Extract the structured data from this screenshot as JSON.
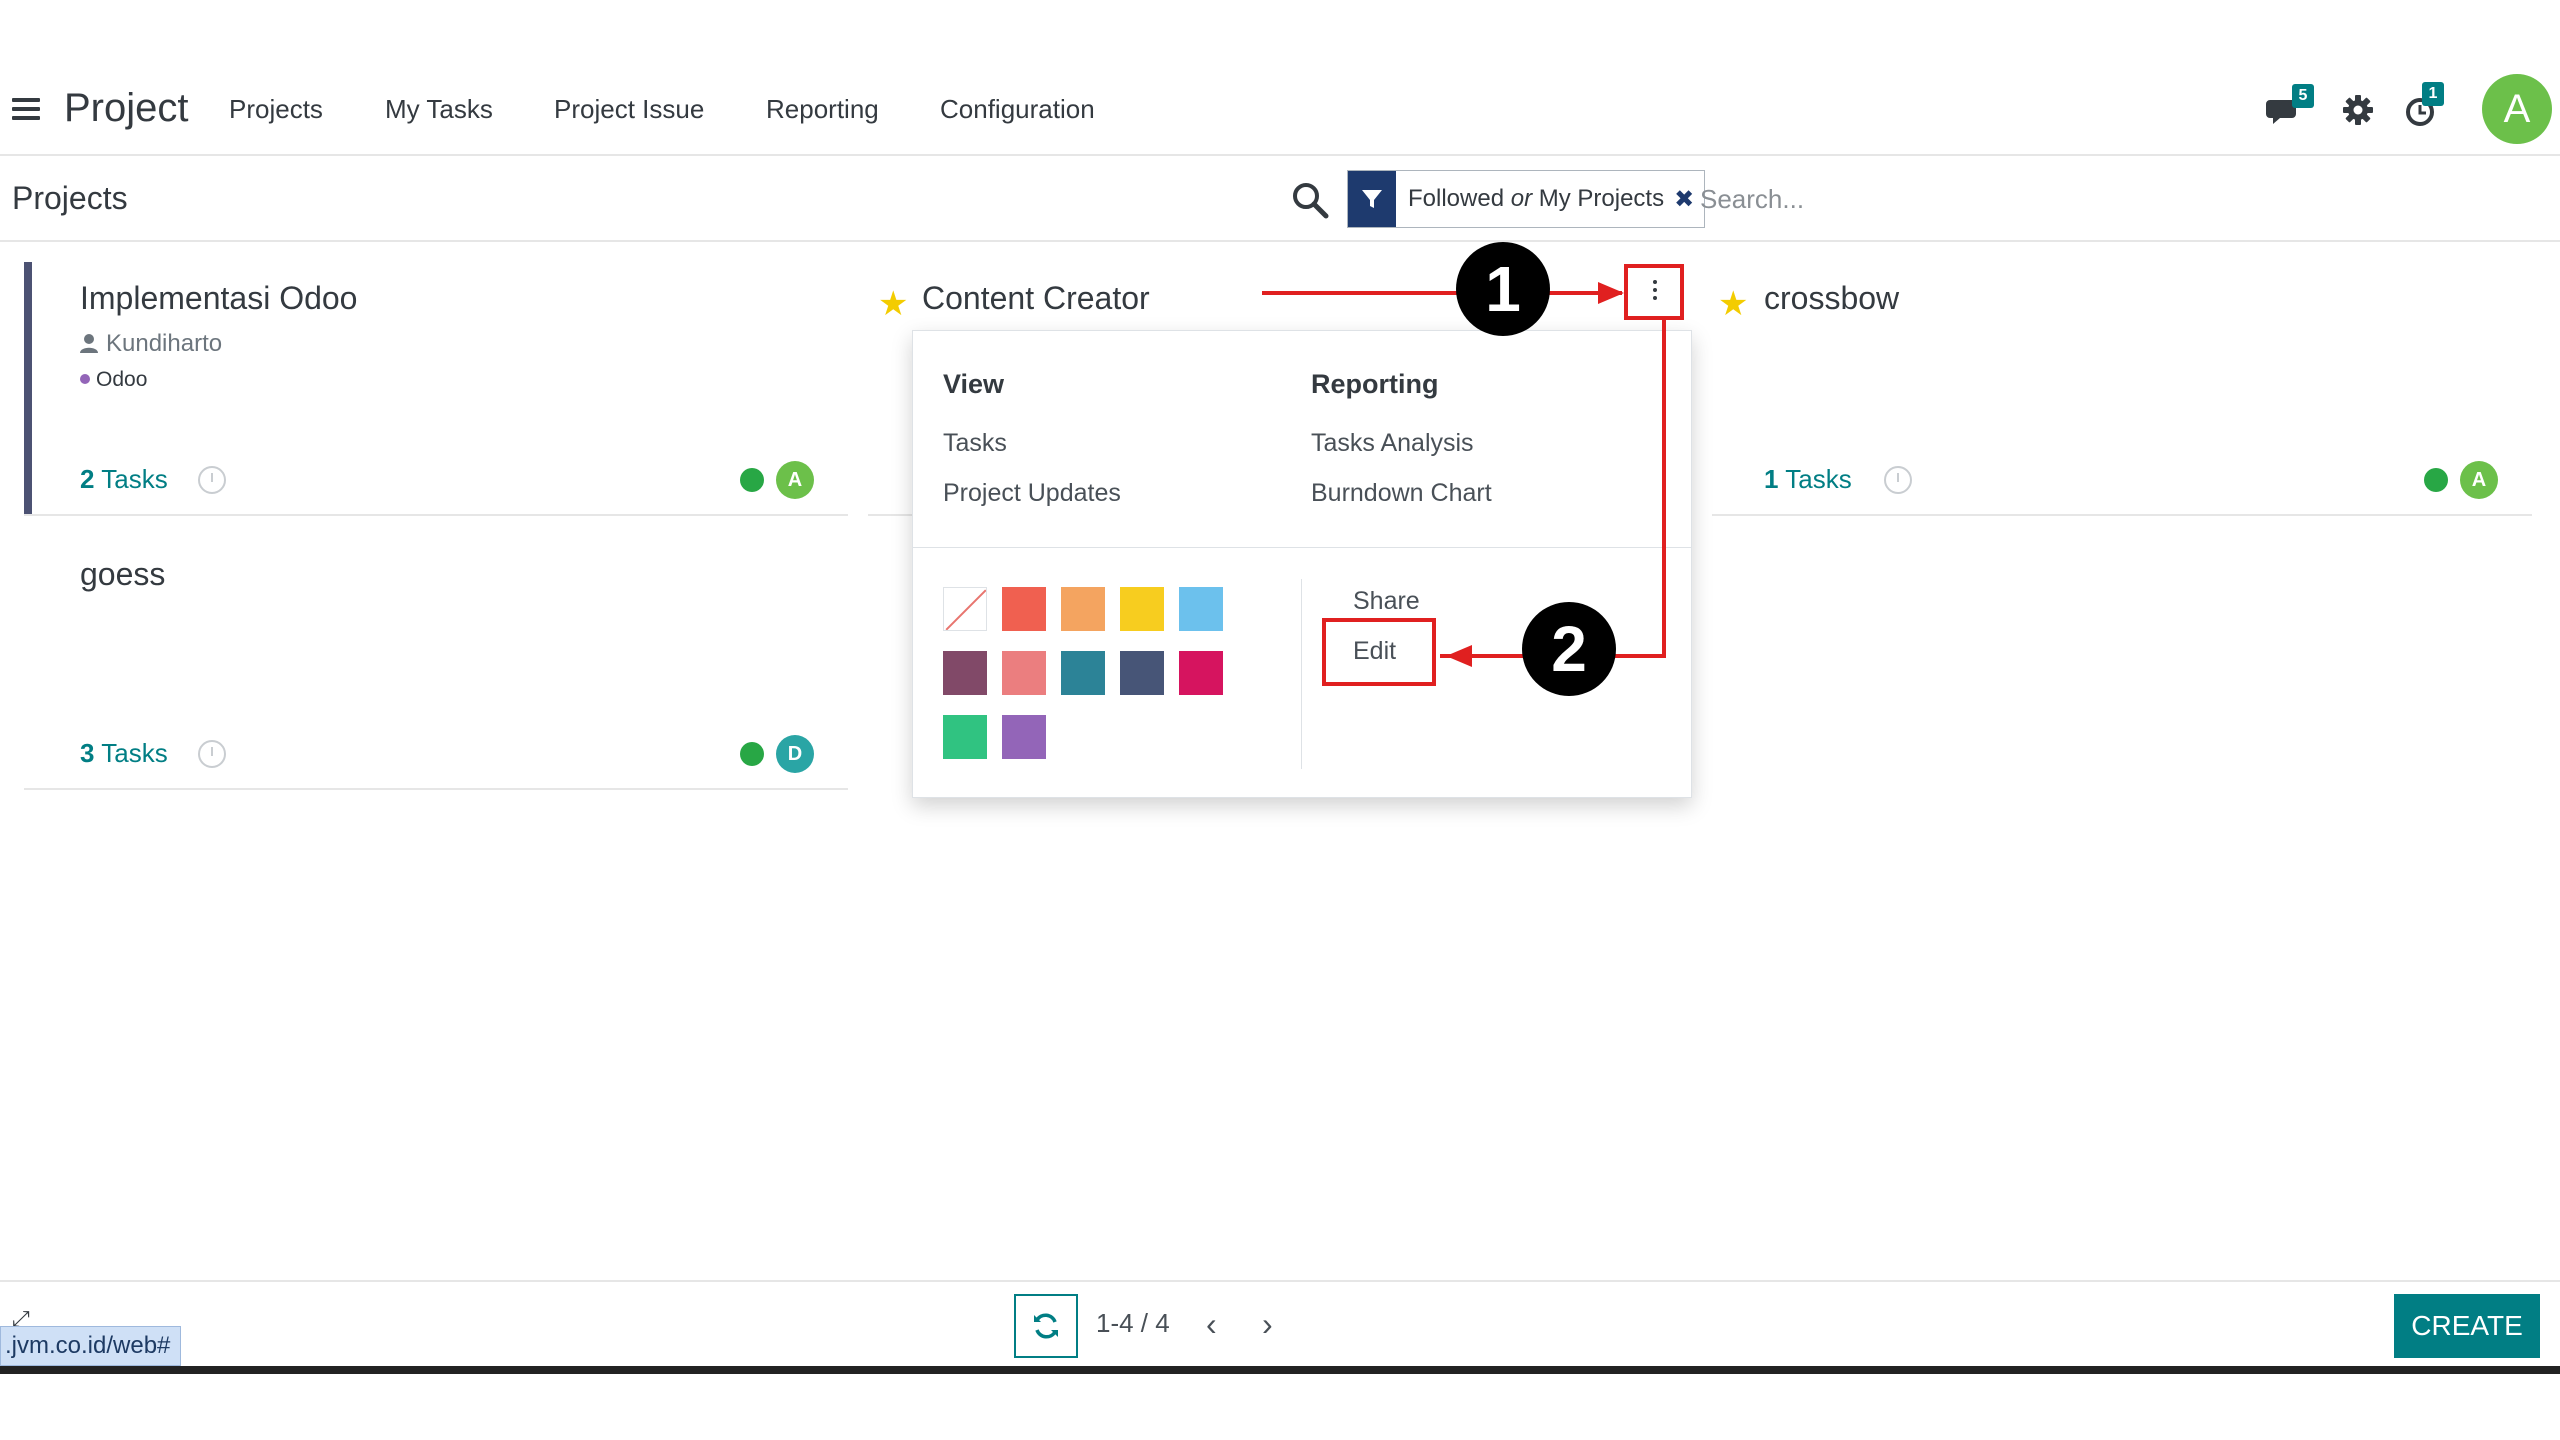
{
  "navbar": {
    "app_title": "Project",
    "menu": [
      "Projects",
      "My Tasks",
      "Project Issue",
      "Reporting",
      "Configuration"
    ],
    "messages_badge": "5",
    "activities_badge": "1",
    "user_initial": "A",
    "icons": [
      "menu-icon",
      "chat-icon",
      "gear-icon",
      "clock-icon"
    ]
  },
  "control_panel": {
    "breadcrumb": "Projects",
    "facet_part1": "Followed",
    "facet_or": "or",
    "facet_part2": "My Projects",
    "facet_remove": "✖",
    "search_placeholder": "Search..."
  },
  "projects": [
    {
      "name": "Implementasi Odoo",
      "manager": "Kundiharto",
      "tag": "Odoo",
      "task_count": "2",
      "task_label": "Tasks",
      "avatar": "A",
      "avatar_color": "#6cc04a",
      "status_color": "#28a745"
    },
    {
      "name": "Content Creator",
      "favorite": true
    },
    {
      "name": "crossbow",
      "favorite": true,
      "task_count": "1",
      "task_label": "Tasks",
      "avatar": "A",
      "avatar_color": "#6cc04a",
      "status_color": "#28a745"
    },
    {
      "name": "goess",
      "task_count": "3",
      "task_label": "Tasks",
      "avatar": "D",
      "avatar_color": "#2aa5a5",
      "status_color": "#28a745"
    }
  ],
  "dropdown": {
    "view_header": "View",
    "view_items": [
      "Tasks",
      "Project Updates"
    ],
    "reporting_header": "Reporting",
    "reporting_items": [
      "Tasks Analysis",
      "Burndown Chart"
    ],
    "actions": [
      "Share",
      "Edit"
    ],
    "colors": [
      "none",
      "#f06050",
      "#f4a460",
      "#f7cd1f",
      "#6cc1ed",
      "#814968",
      "#eb7e7f",
      "#2c8397",
      "#475577",
      "#d6145f",
      "#30c381",
      "#9365b8"
    ]
  },
  "annotations": {
    "step1": "1",
    "step2": "2"
  },
  "pager": {
    "value": "1-4 / 4",
    "prev": "‹",
    "next": "›"
  },
  "create_label": "CREATE",
  "status_url": ".jvm.co.id/web#",
  "accent_color": "#017e84"
}
